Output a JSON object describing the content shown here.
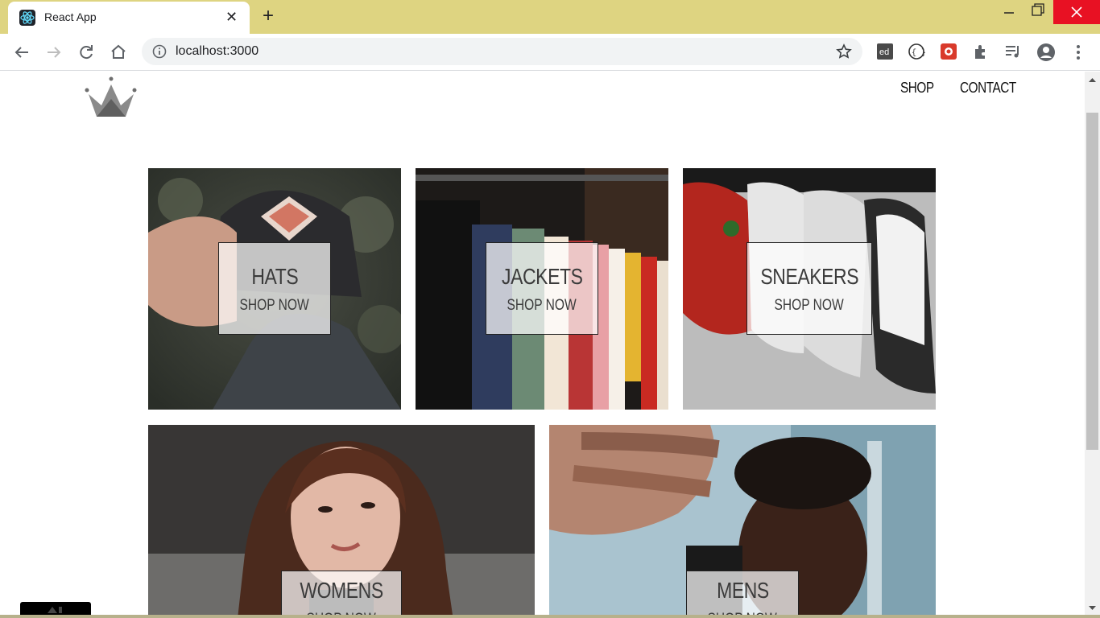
{
  "browser": {
    "tab_title": "React App",
    "tab_close_glyph": "✕",
    "new_tab_glyph": "+",
    "url": "localhost:3000",
    "icons": [
      "react-favicon",
      "back-icon",
      "forward-icon",
      "reload-icon",
      "home-icon",
      "info-icon",
      "star-icon",
      "ed-extension-icon",
      "devtools-extension-icon",
      "bug-extension-icon",
      "puzzle-icon",
      "media-icon",
      "profile-icon",
      "menu-icon"
    ]
  },
  "header": {
    "nav": {
      "shop": "SHOP",
      "contact": "CONTACT"
    }
  },
  "directory": {
    "sections": [
      {
        "title": "HATS",
        "subtitle": "SHOP NOW"
      },
      {
        "title": "JACKETS",
        "subtitle": "SHOP NOW"
      },
      {
        "title": "SNEAKERS",
        "subtitle": "SHOP NOW"
      },
      {
        "title": "WOMENS",
        "subtitle": "SHOP NOW"
      },
      {
        "title": "MENS",
        "subtitle": "SHOP NOW"
      }
    ]
  },
  "colors": {
    "tabbar": "#ded481",
    "close_button": "#e81123",
    "logo_gray": "#757575"
  }
}
